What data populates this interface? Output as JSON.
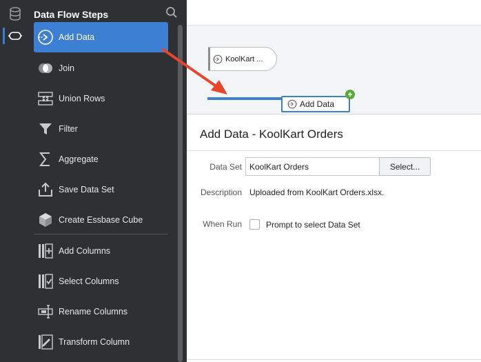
{
  "rail": {
    "icons": [
      "database-icon",
      "dataflow-icon"
    ]
  },
  "panel": {
    "title": "Data Flow Steps",
    "steps": [
      {
        "label": "Add Data",
        "icon": "add-data-icon"
      },
      {
        "label": "Join",
        "icon": "join-icon"
      },
      {
        "label": "Union Rows",
        "icon": "union-rows-icon"
      },
      {
        "label": "Filter",
        "icon": "filter-icon"
      },
      {
        "label": "Aggregate",
        "icon": "sigma-icon"
      },
      {
        "label": "Save Data Set",
        "icon": "upload-icon"
      },
      {
        "label": "Create Essbase Cube",
        "icon": "cube-icon"
      },
      {
        "label": "Add Columns",
        "icon": "add-columns-icon"
      },
      {
        "label": "Select Columns",
        "icon": "select-columns-icon"
      },
      {
        "label": "Rename Columns",
        "icon": "rename-columns-icon"
      },
      {
        "label": "Transform Column",
        "icon": "transform-column-icon"
      }
    ]
  },
  "canvas": {
    "source_node": "KoolKart ...",
    "new_node": "Add Data"
  },
  "properties": {
    "title": "Add Data - KoolKart Orders",
    "data_set_label": "Data Set",
    "data_set_value": "KoolKart Orders",
    "select_button": "Select...",
    "description_label": "Description",
    "description_value": "Uploaded from KoolKart Orders.xlsx.",
    "when_run_label": "When Run",
    "when_run_option": "Prompt to select Data Set",
    "when_run_checked": false
  },
  "colors": {
    "accent": "#3c7fd3",
    "panel_bg": "#2e3033",
    "arrow": "#e8452c",
    "plus": "#5aa93c"
  }
}
